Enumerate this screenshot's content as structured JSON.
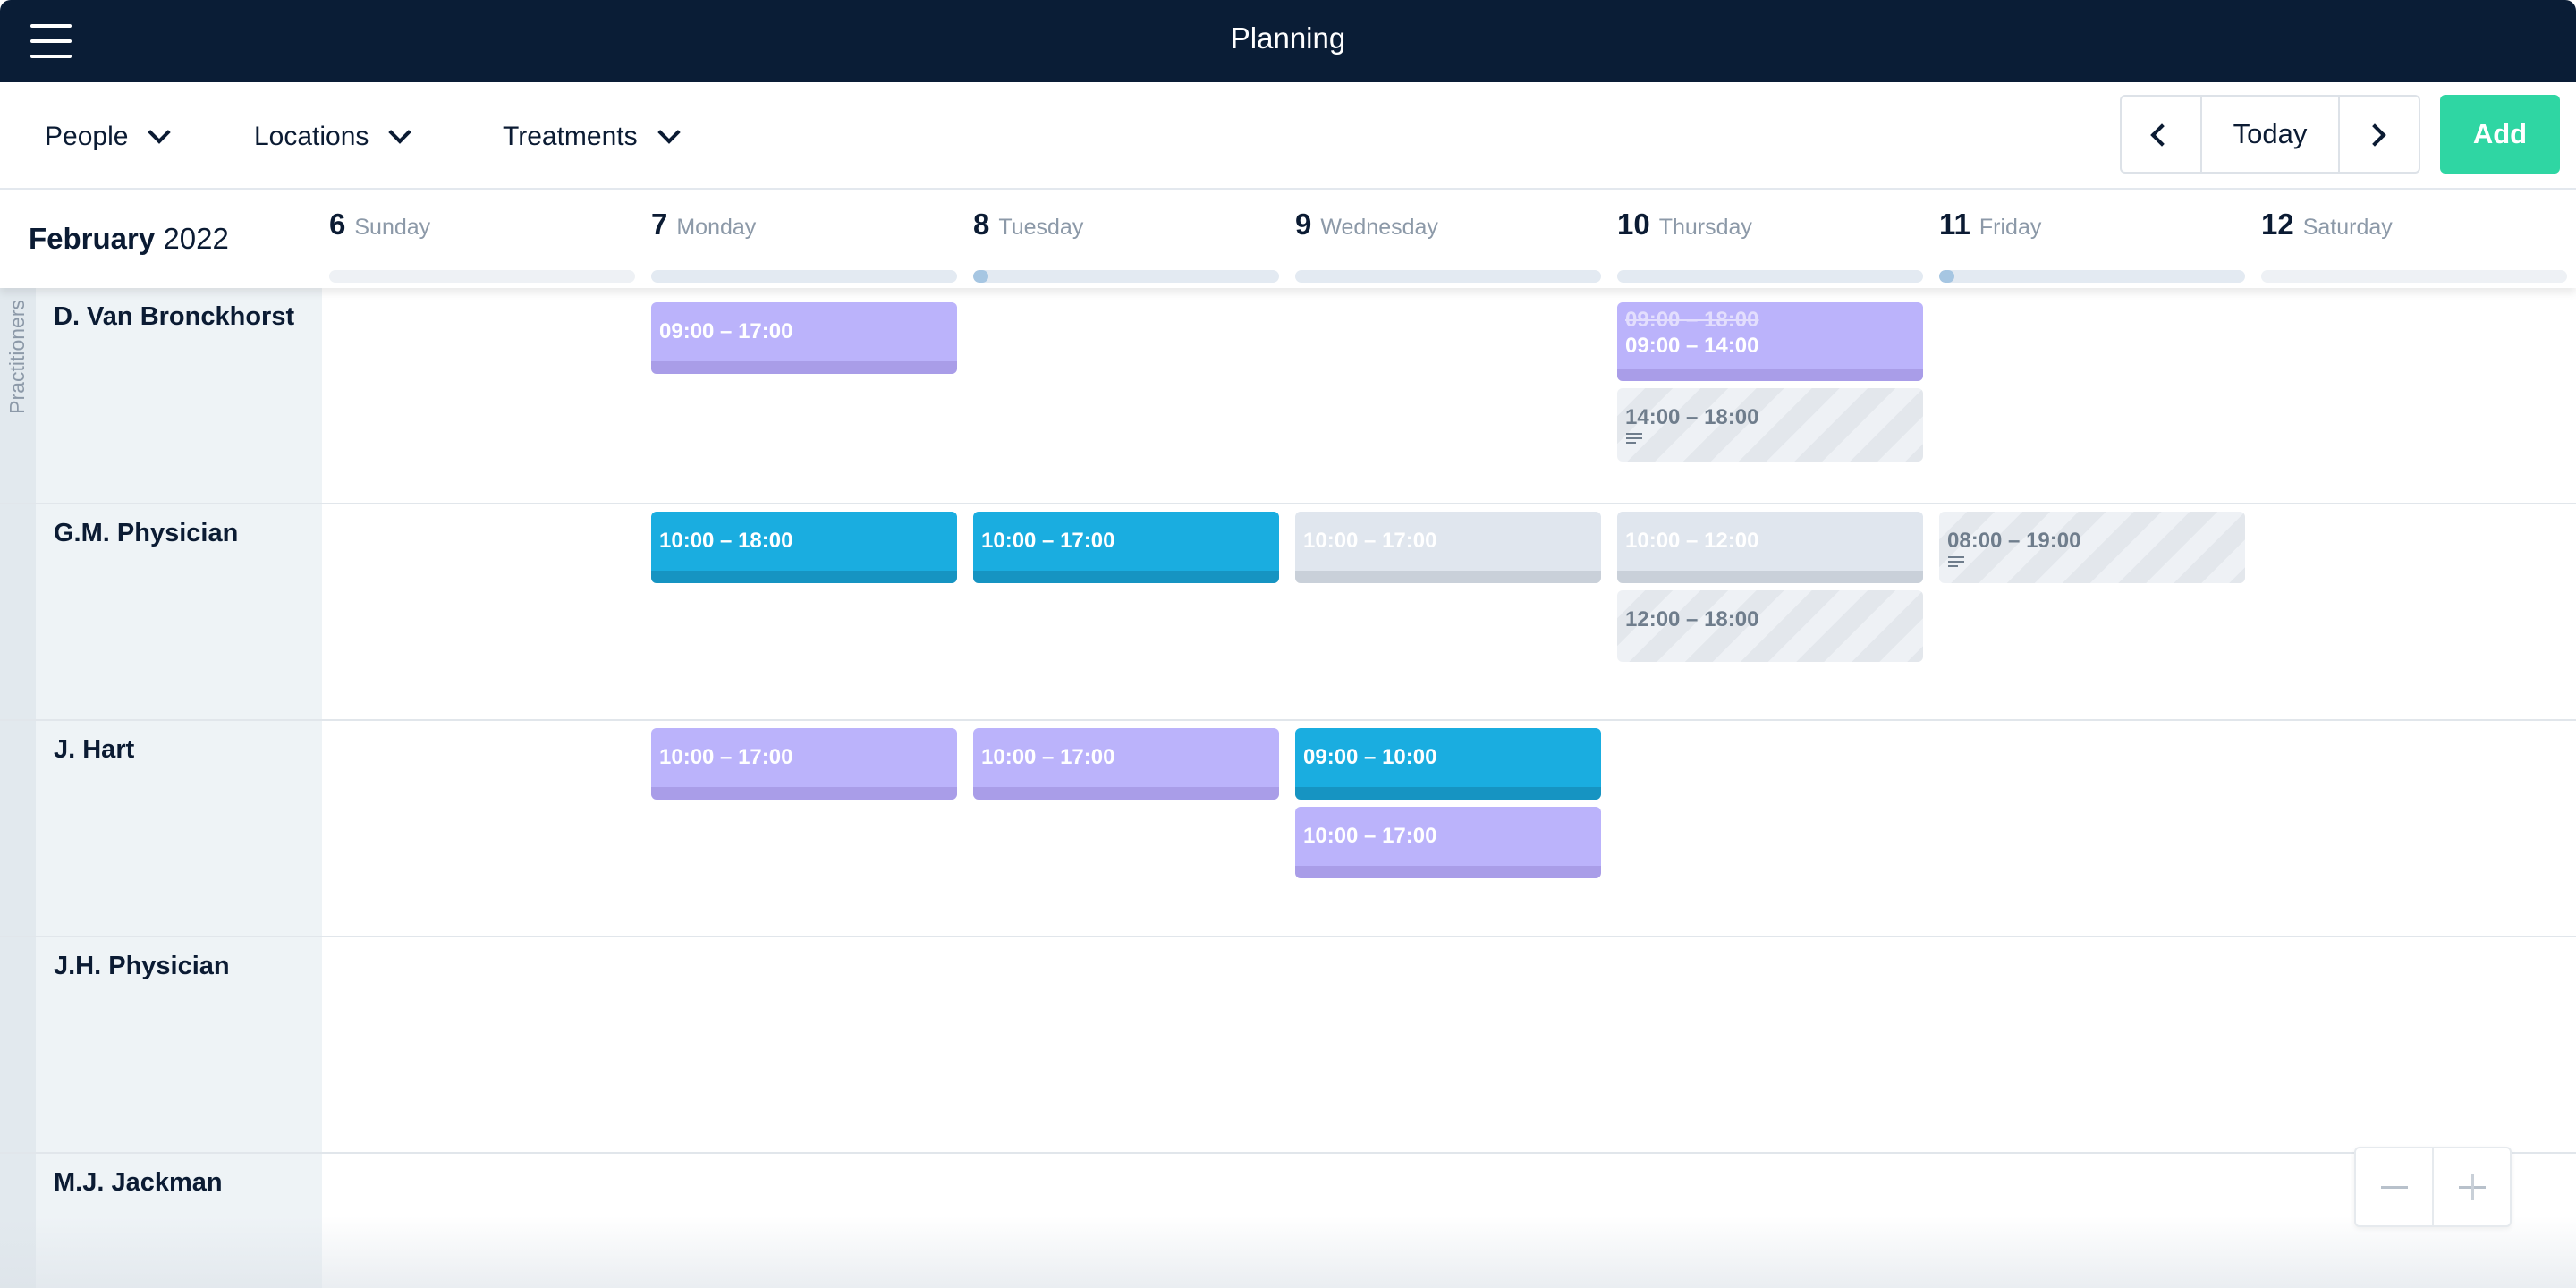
{
  "app": {
    "title": "Planning"
  },
  "toolbar": {
    "filters": [
      "People",
      "Locations",
      "Treatments"
    ],
    "today_label": "Today",
    "add_label": "Add"
  },
  "calendar": {
    "month": "February",
    "year": "2022",
    "days": [
      {
        "num": "6",
        "name": "Sunday",
        "load": 0
      },
      {
        "num": "7",
        "name": "Monday",
        "load": 0
      },
      {
        "num": "8",
        "name": "Tuesday",
        "load": 0.05
      },
      {
        "num": "9",
        "name": "Wednesday",
        "load": 0
      },
      {
        "num": "10",
        "name": "Thursday",
        "load": 0
      },
      {
        "num": "11",
        "name": "Friday",
        "load": 0.05
      },
      {
        "num": "12",
        "name": "Saturday",
        "load": 0
      }
    ]
  },
  "sidebar": {
    "group_label": "Practitioners"
  },
  "practitioners": [
    {
      "name": "D. Van Bronckhorst"
    },
    {
      "name": "G.M. Physician"
    },
    {
      "name": "J. Hart"
    },
    {
      "name": "J.H. Physician"
    },
    {
      "name": "M.J. Jackman"
    }
  ],
  "shifts": {
    "d_van_mon": "09:00 – 17:00",
    "d_van_thu_old": "09:00 – 18:00",
    "d_van_thu_new": "09:00 – 14:00",
    "d_van_thu_pm": "14:00 – 18:00",
    "gm_mon": "10:00 – 18:00",
    "gm_tue": "10:00 – 17:00",
    "gm_wed": "10:00 – 17:00",
    "gm_thu_am": "10:00 – 12:00",
    "gm_thu_pm": "12:00 – 18:00",
    "gm_fri": "08:00 – 19:00",
    "jh_mon": "10:00 – 17:00",
    "jh_tue": "10:00 – 17:00",
    "jh_wed_am": "09:00 – 10:00",
    "jh_wed_pm": "10:00 – 17:00"
  },
  "colors": {
    "topbar": "#0a1d36",
    "add": "#2fd6a3",
    "shift_purple": "#bbb3fb",
    "shift_blue": "#1aade0",
    "shift_grey": "#e0e6ee"
  },
  "icons": {
    "menu": "hamburger-icon",
    "prev": "chevron-left-icon",
    "next": "chevron-right-icon",
    "filter": "chevron-down-icon",
    "note": "note-lines-icon",
    "zoom_out": "minus-icon",
    "zoom_in": "plus-icon"
  }
}
